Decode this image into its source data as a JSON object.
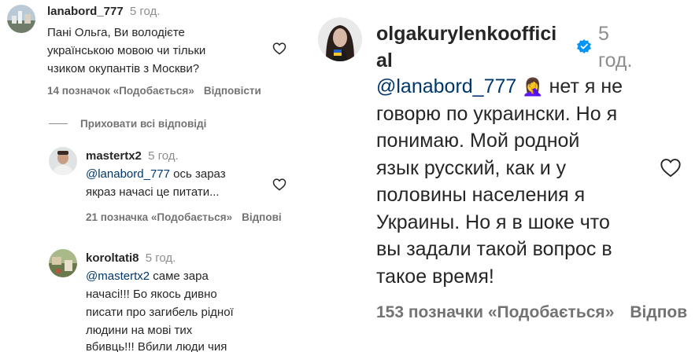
{
  "left_panel": {
    "main_comment": {
      "username": "lanabord_777",
      "time": "5 год.",
      "lines": [
        "Пані Ольга, Ви володієте",
        "українською мовою чи тільки",
        "чзиком окупантів з Москви?"
      ],
      "likes": "14 позначок «Подобається»",
      "reply": "Відповісти"
    },
    "hide_replies": "Приховати всі відповіді",
    "reply_1": {
      "username": "mastertx2",
      "time": "5 год.",
      "mention": "@lanabord_777",
      "line1_rest": " ось зараз",
      "line2": "якраз начасі це питати...",
      "likes": "21 позначка «Подобається»",
      "reply": "Відпові"
    },
    "reply_2": {
      "username": "koroltati8",
      "time": "5 год.",
      "mention": "@mastertx2",
      "line1_rest": " саме зара",
      "lines": [
        "начасі!!! Бо якось дивно",
        "писати про загибель рідної",
        "людини на мові тих",
        "вбивць!!! Вбили люди чия"
      ]
    }
  },
  "right_panel": {
    "username_line1": "olgakurylenkooffici",
    "username_line2": "al",
    "time_line1": "5",
    "time_line2": "год.",
    "mention": "@lanabord_777",
    "emoji": "🤦‍♀️",
    "line1_rest": " нет я не",
    "lines": [
      "говорю по украински. Но я",
      "понимаю. Мой родной",
      "язык русский, как и у",
      "половины населения я",
      "Украины. Но я в шоке что",
      "вы задали такой вопрос в",
      "такое время!"
    ],
    "likes": "153 позначки «Подобається»",
    "reply": "Відпов"
  },
  "colors": {
    "text": "#262626",
    "meta": "#737373",
    "mention": "#00376b",
    "verified": "#0095f6"
  },
  "icons": [
    "heart-icon",
    "verified-badge-icon"
  ]
}
